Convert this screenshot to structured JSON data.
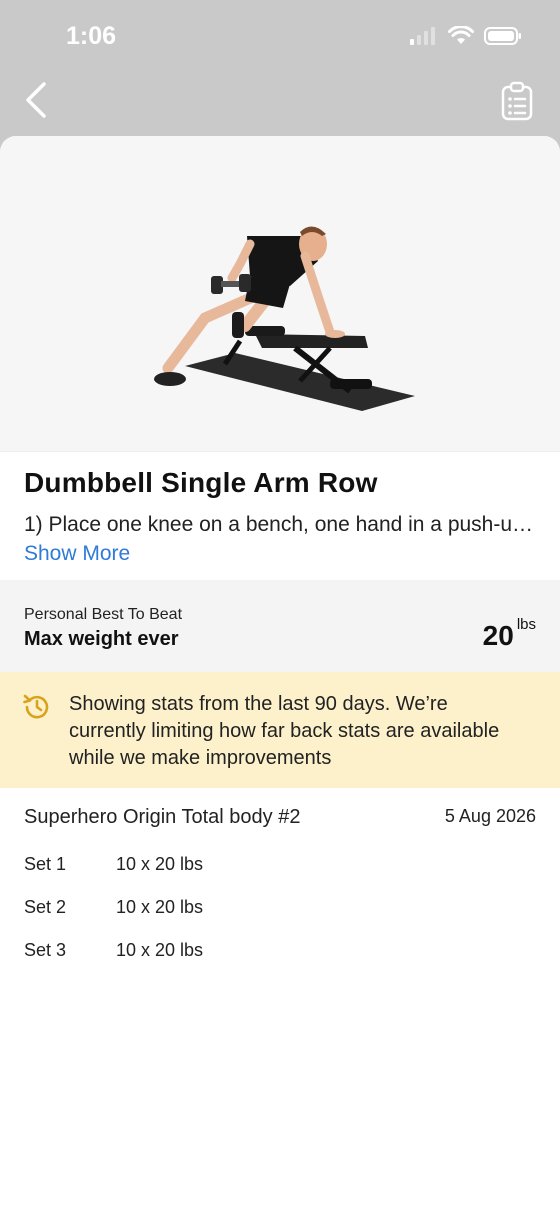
{
  "status_bar": {
    "time": "1:06"
  },
  "nav": {
    "back_icon": "chevron-left-icon",
    "clipboard_icon": "clipboard-list-icon"
  },
  "exercise": {
    "title": "Dumbbell Single Arm Row",
    "description": "1) Place one knee on a bench, one hand in a push-u…",
    "show_more": "Show More"
  },
  "personal_best": {
    "label": "Personal Best To Beat",
    "metric": "Max weight ever",
    "value": "20",
    "unit": "lbs"
  },
  "notice": {
    "icon": "history-icon",
    "text": "Showing stats from the last 90 days. We’re currently limiting how far back stats are available while we make improvements"
  },
  "session": {
    "name": "Superhero Origin Total body #2",
    "date": "5 Aug 2026",
    "sets": [
      {
        "label": "Set 1",
        "value": "10 x 20 lbs"
      },
      {
        "label": "Set 2",
        "value": "10 x 20 lbs"
      },
      {
        "label": "Set 3",
        "value": "10 x 20 lbs"
      }
    ]
  },
  "colors": {
    "accent": "#2f7bd6",
    "notice_bg": "#fdf1cc",
    "notice_icon": "#d9a21b",
    "header_bg": "#c9c9c9"
  }
}
